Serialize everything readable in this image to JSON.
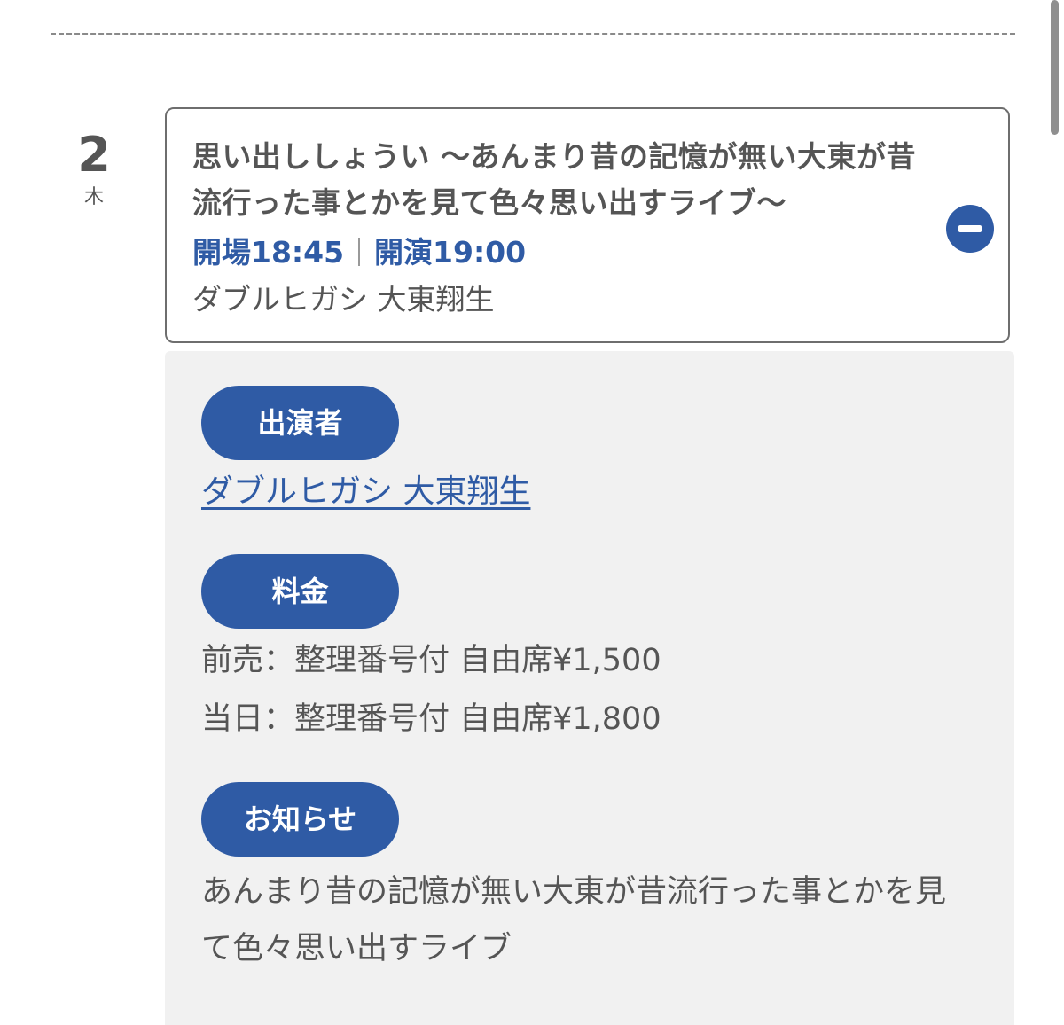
{
  "date": {
    "day": "2",
    "weekday": "木"
  },
  "event": {
    "title": "思い出ししょうい 〜あんまり昔の記憶が無い大東が昔流行った事とかを見て色々思い出すライブ〜",
    "open_time": "開場18:45",
    "start_time": "開演19:00",
    "performer": "ダブルヒガシ 大東翔生",
    "collapse_icon": "minus-circle-icon"
  },
  "details": {
    "performers_label": "出演者",
    "performer_link": "ダブルヒガシ 大東翔生",
    "price_label": "料金",
    "price_advance": "前売：整理番号付 自由席¥1,500",
    "price_door": "当日：整理番号付 自由席¥1,800",
    "notice_label": "お知らせ",
    "notice_text": "あんまり昔の記憶が無い大東が昔流行った事とかを見て色々思い出すライブ"
  },
  "colors": {
    "accent": "#2f5ba5",
    "text": "#555555",
    "panel": "#f1f1f1"
  }
}
